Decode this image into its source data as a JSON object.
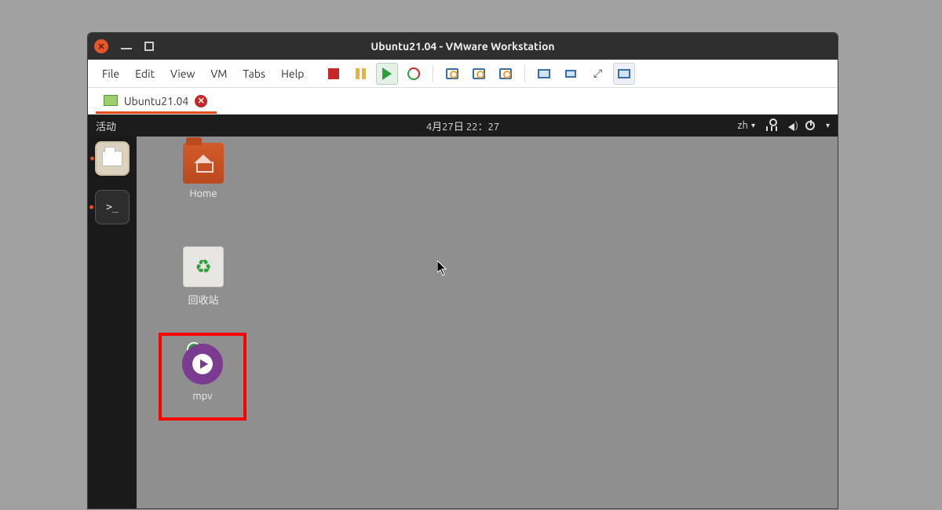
{
  "window": {
    "title": "Ubuntu21.04 - VMware Workstation"
  },
  "menus": {
    "file": "File",
    "edit": "Edit",
    "view": "View",
    "vm": "VM",
    "tabs": "Tabs",
    "help": "Help"
  },
  "tab": {
    "label": "Ubuntu21.04"
  },
  "gnome": {
    "activities": "活动",
    "clock": "4月27日  22：27",
    "lang": "zh"
  },
  "desktop": {
    "home": "Home",
    "trash": "回收站",
    "mpv": "mpv"
  },
  "highlight_color": "#ff0000"
}
